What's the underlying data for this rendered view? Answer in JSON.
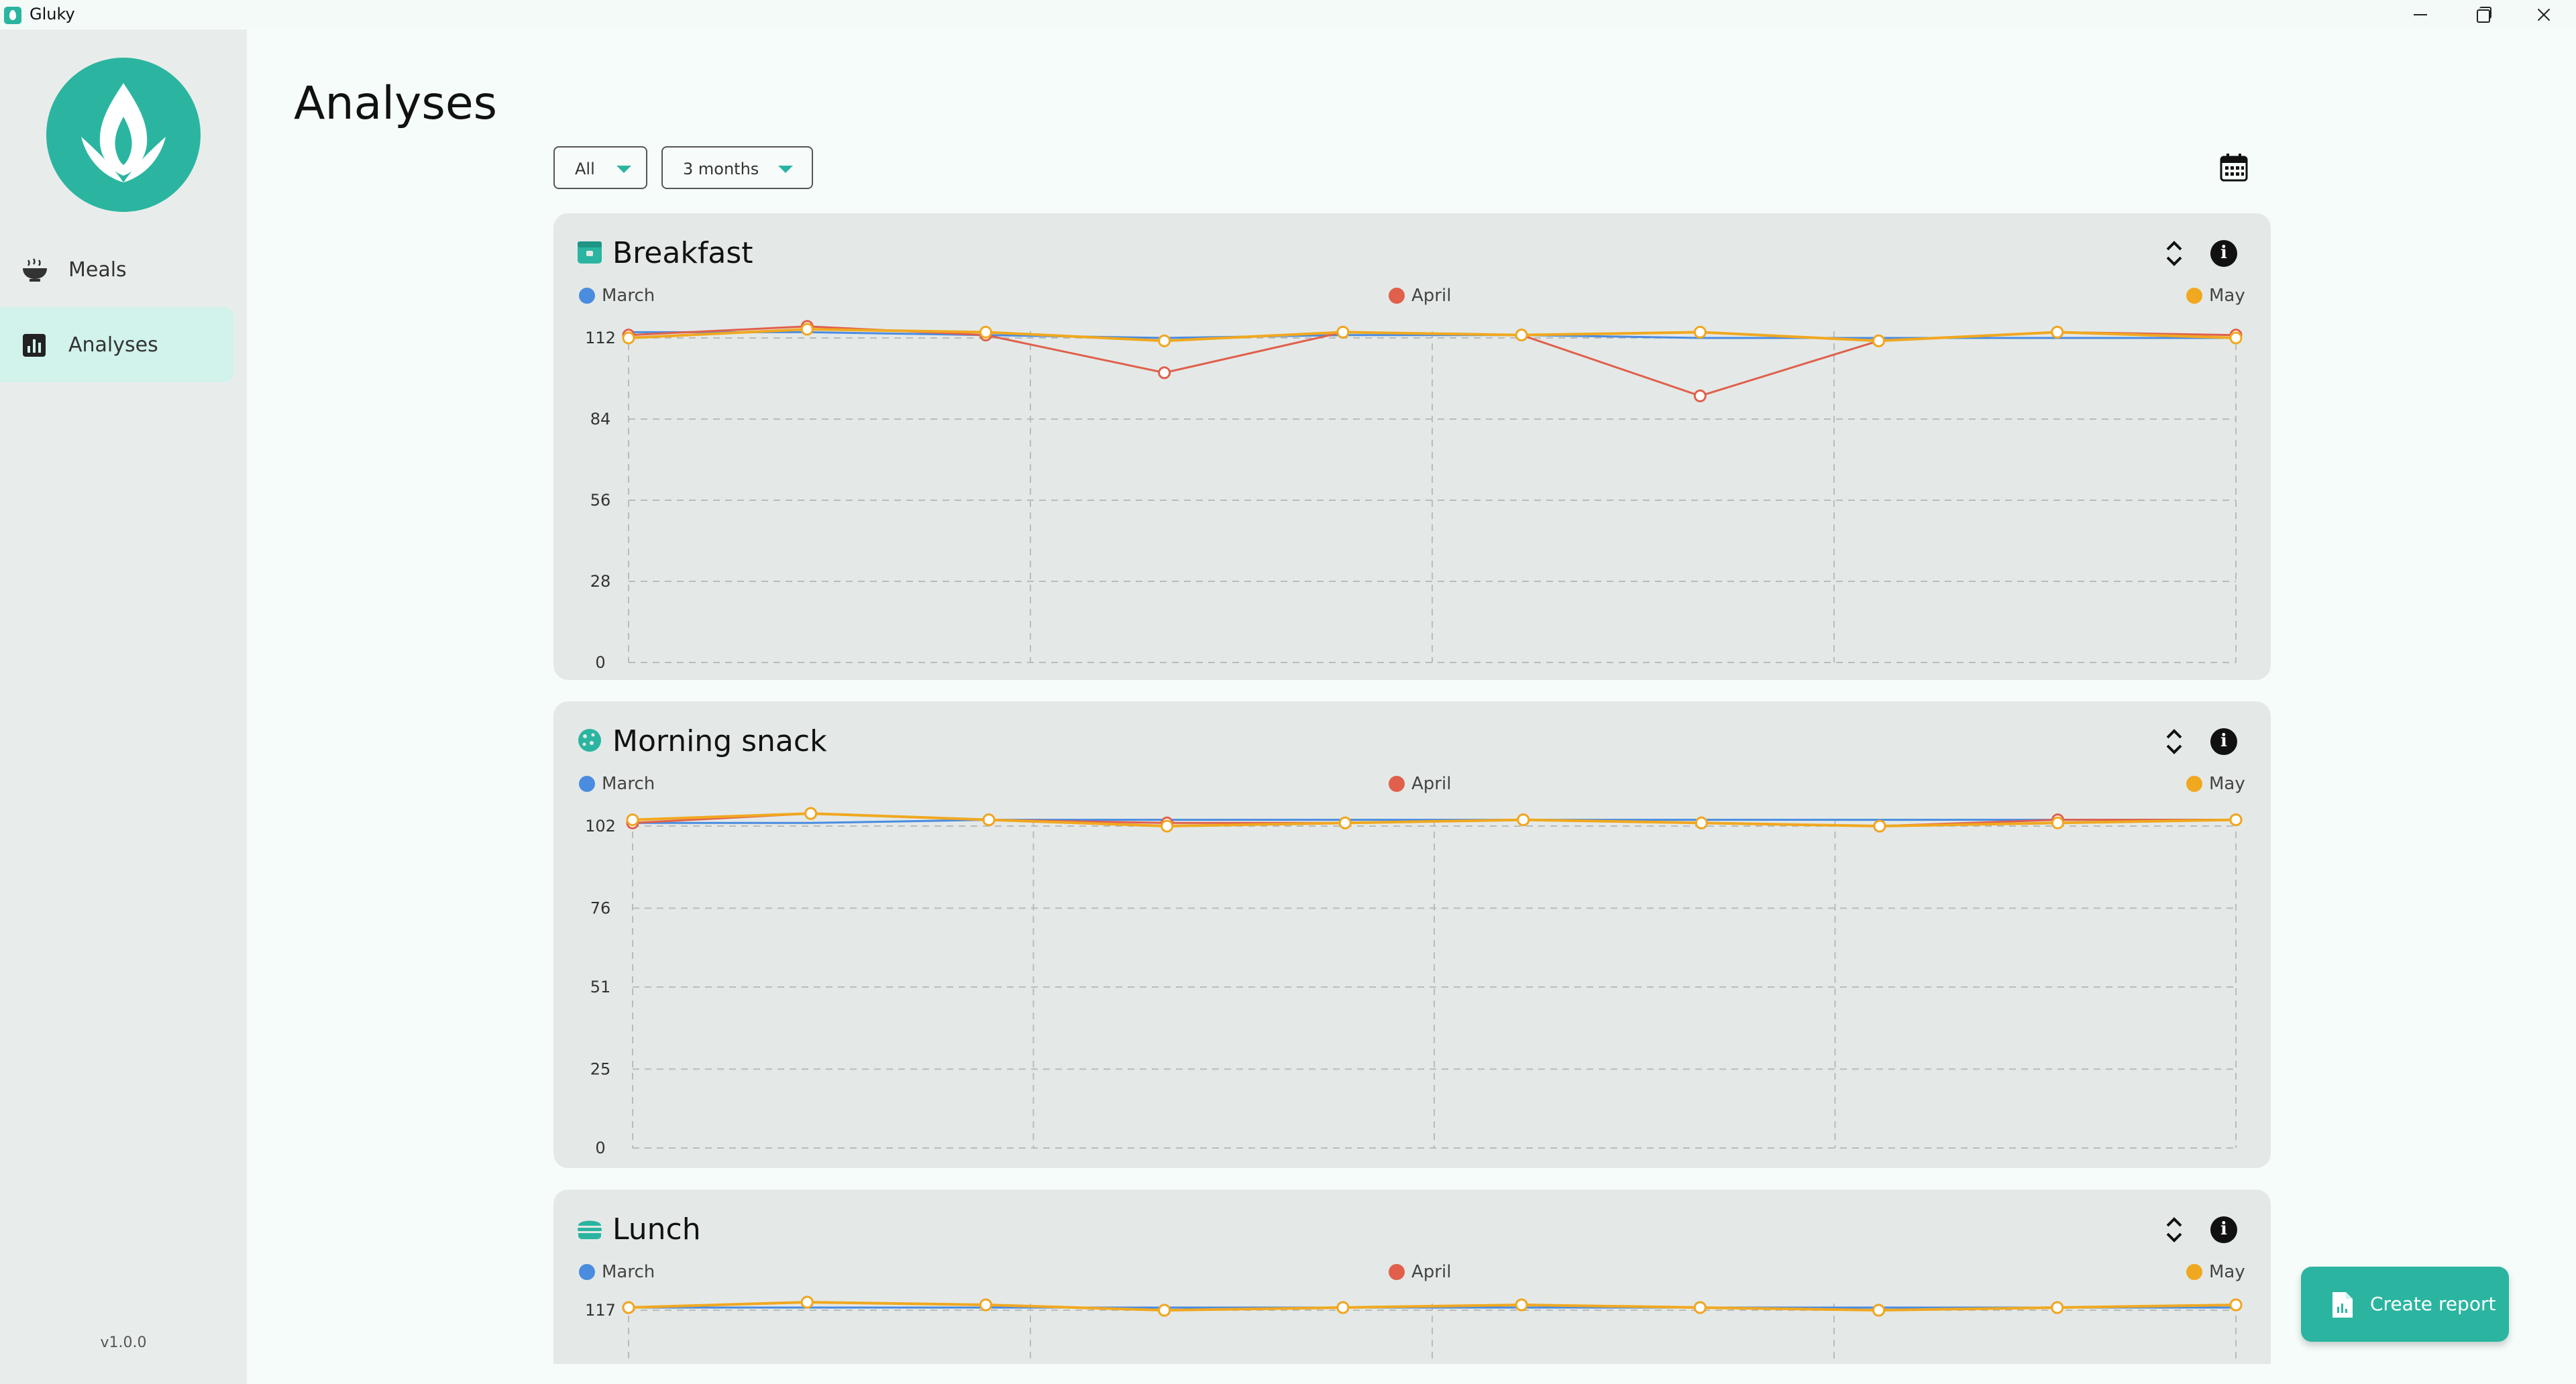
{
  "window": {
    "title": "Gluky"
  },
  "sidebar": {
    "items": [
      {
        "label": "Meals",
        "icon": "bowl-icon",
        "active": false
      },
      {
        "label": "Analyses",
        "icon": "bar-chart-icon",
        "active": true
      }
    ],
    "version": "v1.0.0"
  },
  "page": {
    "title": "Analyses"
  },
  "filters": {
    "meal_filter": {
      "selected": "All"
    },
    "period_filter": {
      "selected": "3 months"
    }
  },
  "legend": [
    "March",
    "April",
    "May"
  ],
  "colors": {
    "accent": "#2bb5a0",
    "march": "#4a8ce0",
    "april": "#e0604c",
    "may": "#f0a820"
  },
  "actions": {
    "create_report": "Create report"
  },
  "chart_data": [
    {
      "type": "line",
      "title": "Breakfast",
      "y_ticks": [
        0,
        28,
        56,
        84,
        112
      ],
      "ylim": [
        0,
        112
      ],
      "x": [
        0,
        1,
        2,
        3,
        4,
        5,
        6,
        7,
        8,
        9
      ],
      "series": [
        {
          "name": "March",
          "values": [
            114,
            114,
            113,
            112,
            113,
            113,
            112,
            112,
            112,
            112
          ]
        },
        {
          "name": "April",
          "values": [
            113,
            116,
            113,
            100,
            114,
            113,
            113,
            111,
            114,
            113
          ]
        },
        {
          "name": "May",
          "values": [
            112,
            115,
            114,
            111,
            114,
            113,
            114,
            111,
            114,
            112
          ]
        }
      ],
      "extra_april_points": [
        {
          "x": 6,
          "y": 92
        }
      ],
      "grid": true,
      "legend_position": "top"
    },
    {
      "type": "line",
      "title": "Morning snack",
      "y_ticks": [
        0,
        25,
        51,
        76,
        102
      ],
      "ylim": [
        0,
        102
      ],
      "x": [
        0,
        1,
        2,
        3,
        4,
        5,
        6,
        7,
        8,
        9
      ],
      "series": [
        {
          "name": "March",
          "values": [
            103,
            103,
            104,
            104,
            104,
            104,
            104,
            104,
            104,
            104
          ]
        },
        {
          "name": "April",
          "values": [
            103,
            106,
            104,
            103,
            103,
            104,
            103,
            102,
            104,
            104
          ]
        },
        {
          "name": "May",
          "values": [
            104,
            106,
            104,
            102,
            103,
            104,
            103,
            102,
            103,
            104
          ]
        }
      ],
      "grid": true,
      "legend_position": "top"
    },
    {
      "type": "line",
      "title": "Lunch",
      "y_ticks": [
        117
      ],
      "ylim": [
        0,
        117
      ],
      "x": [
        0,
        1,
        2,
        3,
        4,
        5,
        6,
        7,
        8,
        9
      ],
      "series": [
        {
          "name": "March",
          "values": [
            118,
            118,
            118,
            118,
            118,
            118,
            118,
            118,
            118,
            118
          ]
        },
        {
          "name": "April",
          "values": [
            118,
            120,
            119,
            117,
            118,
            119,
            118,
            117,
            118,
            119
          ]
        },
        {
          "name": "May",
          "values": [
            118,
            120,
            119,
            117,
            118,
            119,
            118,
            117,
            118,
            119
          ]
        }
      ],
      "grid": true,
      "legend_position": "top"
    }
  ]
}
